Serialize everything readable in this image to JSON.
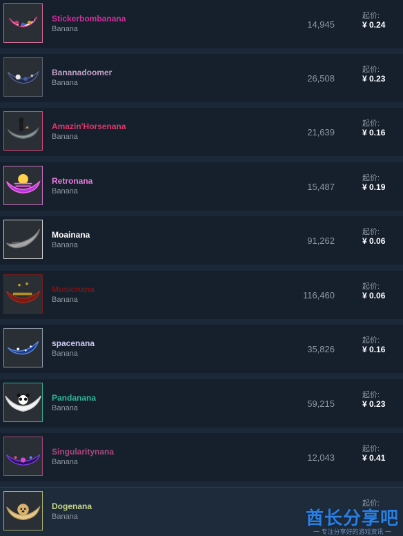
{
  "listings": [
    {
      "name": "Stickerbombanana",
      "game": "Banana",
      "quantity": "14,945",
      "price_label": "起价:",
      "price": "¥ 0.24",
      "name_color": "#cf2f9a",
      "border_color": "#cf6a95",
      "icon": "sticker-banana-icon"
    },
    {
      "name": "Bananadoomer",
      "game": "Banana",
      "quantity": "26,508",
      "price_label": "起价:",
      "price": "¥ 0.23",
      "name_color": "#c1a0c8",
      "border_color": "#5a6170",
      "icon": "doom-banana-icon"
    },
    {
      "name": "Amazin'Horsenana",
      "game": "Banana",
      "quantity": "21,639",
      "price_label": "起价:",
      "price": "¥ 0.16",
      "name_color": "#e0366a",
      "border_color": "#cf4a78",
      "icon": "horse-banana-icon"
    },
    {
      "name": "Retronana",
      "game": "Banana",
      "quantity": "15,487",
      "price_label": "起价:",
      "price": "¥ 0.19",
      "name_color": "#e77bdc",
      "border_color": "#c56fbf",
      "icon": "retro-banana-icon"
    },
    {
      "name": "Moainana",
      "game": "Banana",
      "quantity": "91,262",
      "price_label": "起价:",
      "price": "¥ 0.06",
      "name_color": "#ffffff",
      "border_color": "#d0d0d0",
      "icon": "moai-banana-icon"
    },
    {
      "name": "Musicnana",
      "game": "Banana",
      "quantity": "116,460",
      "price_label": "起价:",
      "price": "¥ 0.06",
      "name_color": "#7a1414",
      "border_color": "#6a1e1e",
      "icon": "music-banana-icon"
    },
    {
      "name": "spacenana",
      "game": "Banana",
      "quantity": "35,826",
      "price_label": "起价:",
      "price": "¥ 0.16",
      "name_color": "#d0c8f0",
      "border_color": "#8f98a8",
      "icon": "space-banana-icon"
    },
    {
      "name": "Pandanana",
      "game": "Banana",
      "quantity": "59,215",
      "price_label": "起价:",
      "price": "¥ 0.23",
      "name_color": "#2fb79a",
      "border_color": "#3aa88e",
      "icon": "panda-banana-icon"
    },
    {
      "name": "Singularitynana",
      "game": "Banana",
      "quantity": "12,043",
      "price_label": "起价:",
      "price": "¥ 0.41",
      "name_color": "#a8487c",
      "border_color": "#9a4a78",
      "icon": "singularity-banana-icon"
    },
    {
      "name": "Dogenana",
      "game": "Banana",
      "quantity": "",
      "price_label": "起价:",
      "price": "",
      "name_color": "#c8d88a",
      "border_color": "#aab070",
      "icon": "doge-banana-icon"
    }
  ],
  "watermark": {
    "title": "酋长分享吧",
    "subtitle": "一 专注分享好的游戏资讯 一"
  }
}
